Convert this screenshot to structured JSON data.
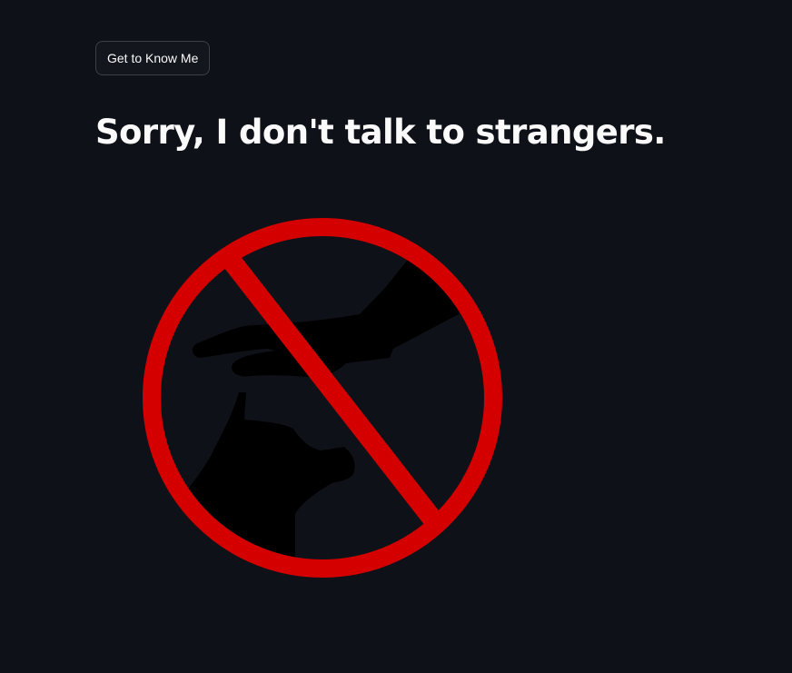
{
  "header": {
    "button_label": "Get to Know Me"
  },
  "main": {
    "headline": "Sorry, I don't talk to strangers."
  },
  "image": {
    "icon": "no-petting-dog-icon",
    "colors": {
      "ring": "#d40000",
      "silhouette": "#000000"
    }
  }
}
